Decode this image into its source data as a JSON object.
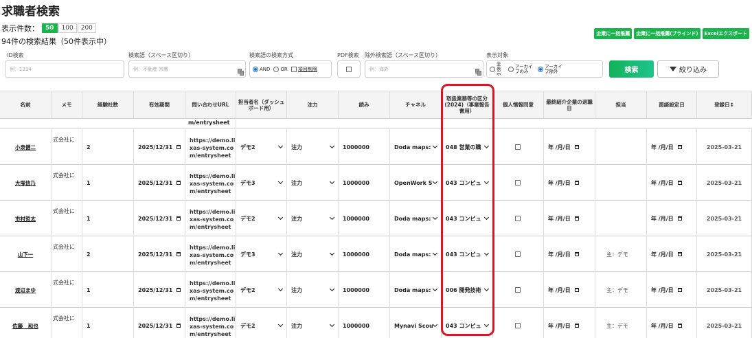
{
  "page": {
    "title": "求職者検索",
    "page_size_label": "表示件数：",
    "page_sizes": [
      "50",
      "100",
      "200"
    ],
    "selected_page_size": "50",
    "results_summary": "94件の検索結果（50件表示中）"
  },
  "actions": {
    "bulk_recommend": "企業に一括推薦",
    "bulk_recommend_blind": "企業に一括推薦(ブラインド)",
    "excel_export": "Excelエクスポート"
  },
  "filters": {
    "id_label": "ID検索",
    "id_placeholder": "例：1234",
    "keyword_label": "検索語（スペース区切り）",
    "keyword_placeholder": "例：不動産 宗教",
    "method_label": "検索語の検索方式",
    "and_label": "AND",
    "or_label": "OR",
    "item_limit_label": "項目制限",
    "pdf_label": "PDF検索",
    "exclude_label": "除外検索語（スペース区切り）",
    "exclude_placeholder": "例：海外",
    "target_label": "表示対象",
    "target_all": "全表示",
    "target_archive_only": "アーカイブのみ",
    "target_archive_exclude": "アーカイブ除外",
    "search_button": "検索",
    "narrow_button": "絞り込み"
  },
  "columns": [
    "名前",
    "メモ",
    "経験社数",
    "有効期間",
    "問い合わせURL",
    "担当者名（ダッシュボード用）",
    "注力",
    "読み",
    "チャネル",
    "取扱業務等の区分(2024)（事業報告書用）",
    "個人情報同意",
    "最終紹介企業の退職日",
    "担当",
    "面談設定日",
    "登録日↕"
  ],
  "partial_top_url": "m/entrysheet",
  "rows": [
    {
      "name": "小泉健二",
      "memo": "式会社に",
      "companies": "2",
      "expiry": "2025/12/31",
      "url": [
        "https://demo.li",
        "xas-system.co",
        "m/entrysheet"
      ],
      "person": "デモ2",
      "focus": "注力",
      "reading": "1000000",
      "channel": "Doda maps:",
      "category": "048 営業の職",
      "manager": "",
      "interview": "年 /月/日",
      "last_exit": "年 /月/日",
      "registered": "2025-03-21"
    },
    {
      "name": "大塚信乃",
      "memo": "式会社に",
      "companies": "1",
      "expiry": "2025/12/31",
      "url": [
        "https://demo.li",
        "xas-system.co",
        "m/entrysheet"
      ],
      "person": "デモ3",
      "focus": "注力",
      "reading": "1000000",
      "channel": "OpenWork S",
      "category": "043 コンピュ",
      "manager": "",
      "interview": "年 /月/日",
      "last_exit": "年 /月/日",
      "registered": "2025-03-21"
    },
    {
      "name": "市村哲太",
      "memo": "式会社に",
      "companies": "1",
      "expiry": "2025/12/31",
      "url": [
        "https://demo.li",
        "xas-system.co",
        "m/entrysheet"
      ],
      "person": "デモ2",
      "focus": "注力",
      "reading": "1000000",
      "channel": "Doda maps:",
      "category": "043 コンピュ",
      "manager": "",
      "interview": "年 /月/日",
      "last_exit": "年 /月/日",
      "registered": "2025-03-21"
    },
    {
      "name": "山下一",
      "memo": "式会社に",
      "companies": "2",
      "expiry": "2025/12/31",
      "url": [
        "https://demo.li",
        "xas-system.co",
        "m/entrysheet"
      ],
      "person": "デモ3",
      "focus": "注力",
      "reading": "1000000",
      "channel": "Doda maps:",
      "category": "043 コンピュ",
      "manager": "主：デモ",
      "interview": "年 /月/日",
      "last_exit": "年 /月/日",
      "registered": "2025-03-21"
    },
    {
      "name": "渡辺まゆ",
      "memo": "式会社に",
      "companies": "1",
      "expiry": "2025/12/31",
      "url": [
        "https://demo.li",
        "xas-system.co",
        "m/entrysheet"
      ],
      "person": "デモ2",
      "focus": "注力",
      "reading": "1000000",
      "channel": "Doda maps:",
      "category": "006 開発技術",
      "manager": "主：デモ",
      "interview": "年 /月/日",
      "last_exit": "年 /月/日",
      "registered": "2025-03-21"
    },
    {
      "name": "佐藤　和也",
      "memo": "式会社に",
      "companies": "1",
      "expiry": "2025/12/31",
      "url": [
        "https://demo.li",
        "xas-system.co",
        "m/entrysheet"
      ],
      "person": "デモ2",
      "focus": "注力",
      "reading": "1000000",
      "channel": "Mynavi Scou",
      "category": "043 コンピュ",
      "manager": "主：デモ",
      "interview": "年 /月/日",
      "last_exit": "年 /月/日",
      "registered": "2025-03-21"
    }
  ]
}
